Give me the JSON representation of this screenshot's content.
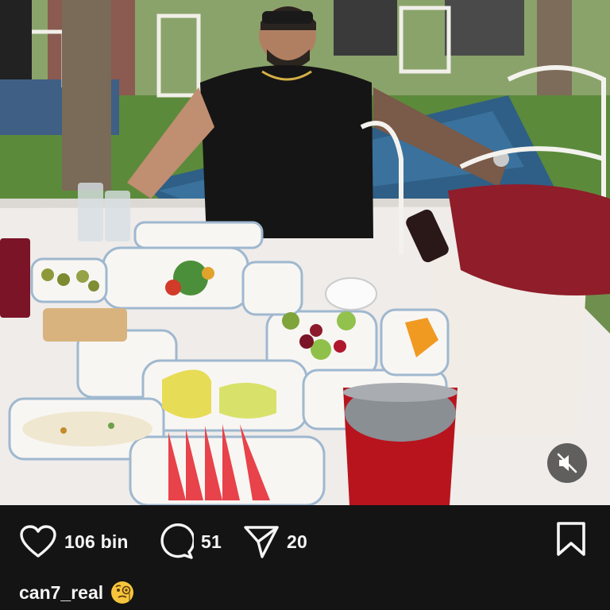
{
  "post": {
    "media_type": "video",
    "mute_icon": "speaker-muted-icon"
  },
  "actions": {
    "like": {
      "icon": "heart-icon",
      "count": "106 bin"
    },
    "comment": {
      "icon": "comment-bubble-icon",
      "count": "51"
    },
    "share": {
      "icon": "send-icon",
      "count": "20"
    },
    "save": {
      "icon": "bookmark-icon"
    }
  },
  "caption": {
    "username": "can7_real",
    "emoji_icon": "face-with-monocle-emoji"
  },
  "colors": {
    "bar_background": "#141414",
    "text": "#f5f5f5",
    "mute_button_bg": "#282828"
  }
}
